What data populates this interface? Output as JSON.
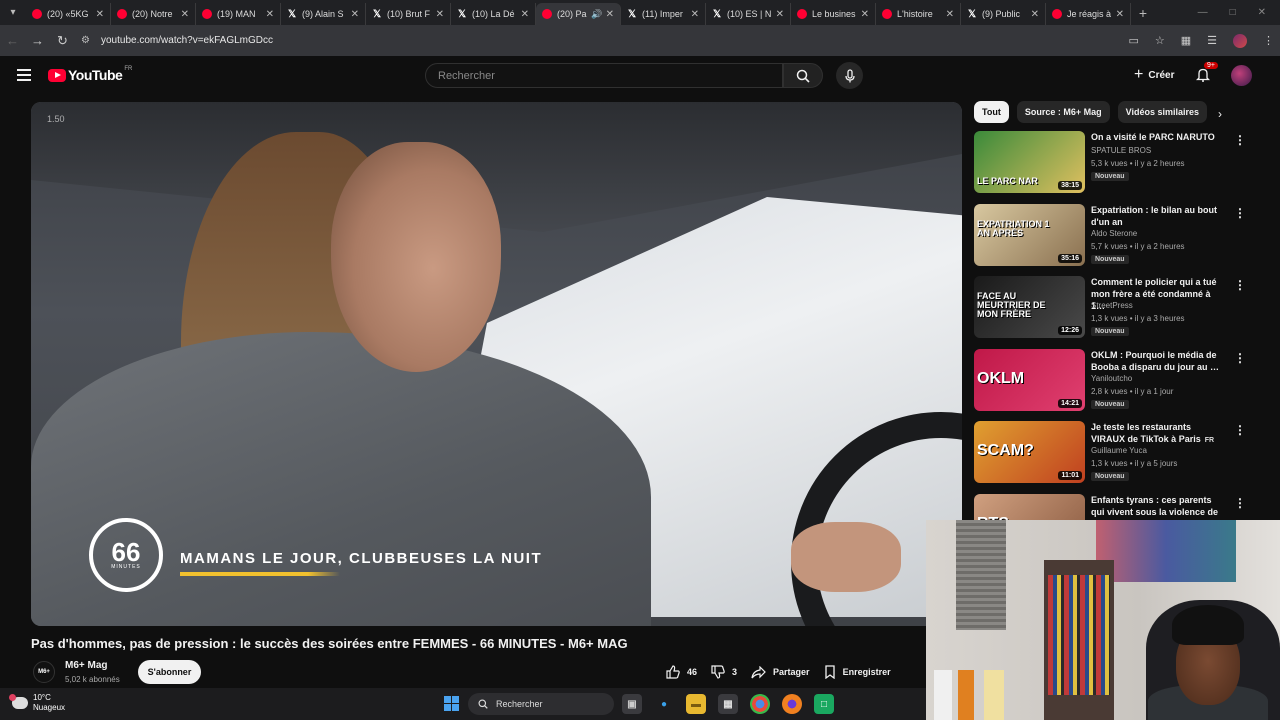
{
  "browser": {
    "tabs": [
      {
        "title": "(20) «5KG",
        "icon": "youtube"
      },
      {
        "title": "(20) Notre",
        "icon": "youtube"
      },
      {
        "title": "(19) MAN",
        "icon": "youtube"
      },
      {
        "title": "(9) Alain S",
        "icon": "x"
      },
      {
        "title": "(10) Brut F",
        "icon": "x"
      },
      {
        "title": "(10) La Dé",
        "icon": "x"
      },
      {
        "title": "(20) Pa",
        "icon": "youtube",
        "active": true
      },
      {
        "title": "(11) Imper",
        "icon": "x"
      },
      {
        "title": "(10) ES | N",
        "icon": "x"
      },
      {
        "title": "Le busines",
        "icon": "youtube"
      },
      {
        "title": "L'histoire",
        "icon": "youtube"
      },
      {
        "title": "(9) Public",
        "icon": "x"
      },
      {
        "title": "Je réagis à",
        "icon": "youtube"
      }
    ],
    "url": "youtube.com/watch?v=ekFAGLmGDcc"
  },
  "youtube": {
    "logo_text": "YouTube",
    "region": "FR",
    "search_placeholder": "Rechercher",
    "create_label": "Créer",
    "notif_badge": "9+"
  },
  "player": {
    "speed": "1.50",
    "show_logo_number": "66",
    "show_logo_sub": "MINUTES",
    "overlay_title": "MAMANS LE JOUR, CLUBBEUSES LA NUIT"
  },
  "video": {
    "title": "Pas d'hommes, pas de pression : le succès des soirées entre FEMMES - 66 MINUTES - M6+ MAG",
    "channel": "M6+ Mag",
    "channel_avatar_text": "M6+",
    "subscribers": "5,02 k abonnés",
    "subscribe_label": "S'abonner",
    "likes": "46",
    "dislikes": "3",
    "share_label": "Partager",
    "save_label": "Enregistrer"
  },
  "chips": [
    "Tout",
    "Source : M6+ Mag",
    "Vidéos similaires"
  ],
  "recommendations": [
    {
      "title": "On a visité le PARC NARUTO",
      "channel": "SPATULE BROS",
      "meta": "5,3 k vues • il y a 2 heures",
      "badge": "Nouveau",
      "duration": "38:15",
      "thumb_text": "LE PARC NAR",
      "colors": [
        "#3a8a3a",
        "#e0c060"
      ]
    },
    {
      "title": "Expatriation : le bilan au bout d'un an",
      "channel": "Aldo Sterone",
      "meta": "5,7 k vues • il y a 2 heures",
      "badge": "Nouveau",
      "duration": "35:16",
      "thumb_text": "EXPATRIATION 1 AN APRÈS",
      "colors": [
        "#d8c8a0",
        "#8a7050"
      ]
    },
    {
      "title": "Comment le policier qui a tué mon frère a été condamné à 1…",
      "channel": "StreetPress",
      "meta": "1,3 k vues • il y a 3 heures",
      "badge": "Nouveau",
      "duration": "12:26",
      "thumb_text": "FACE AU MEURTRIER DE MON FRÈRE",
      "colors": [
        "#1a1a1a",
        "#4a4a4a"
      ]
    },
    {
      "title": "OKLM : Pourquoi le média de Booba a disparu du jour au …",
      "channel": "Yaniloutcho",
      "meta": "2,8 k vues • il y a 1 jour",
      "badge": "Nouveau",
      "duration": "14:21",
      "thumb_text": "OKLM",
      "colors": [
        "#c01848",
        "#e04070"
      ]
    },
    {
      "title": "Je teste les restaurants VIRAUX de TikTok à Paris",
      "channel": "Guillaume Yuca",
      "meta": "1,3 k vues • il y a 5 jours",
      "badge": "Nouveau",
      "duration": "11:01",
      "thumb_text": "SCAM?",
      "colors": [
        "#e0a030",
        "#c04020"
      ],
      "title_badge": "FR"
    },
    {
      "title": "Enfants tyrans : ces parents qui vivent sous la violence de leur …",
      "channel": "",
      "meta": "",
      "badge": "",
      "duration": "",
      "thumb_text": "RTS",
      "colors": [
        "#d0a080",
        "#8a5a40"
      ]
    }
  ],
  "taskbar": {
    "temperature": "10°C",
    "weather": "Nuageux",
    "search_label": "Rechercher"
  }
}
